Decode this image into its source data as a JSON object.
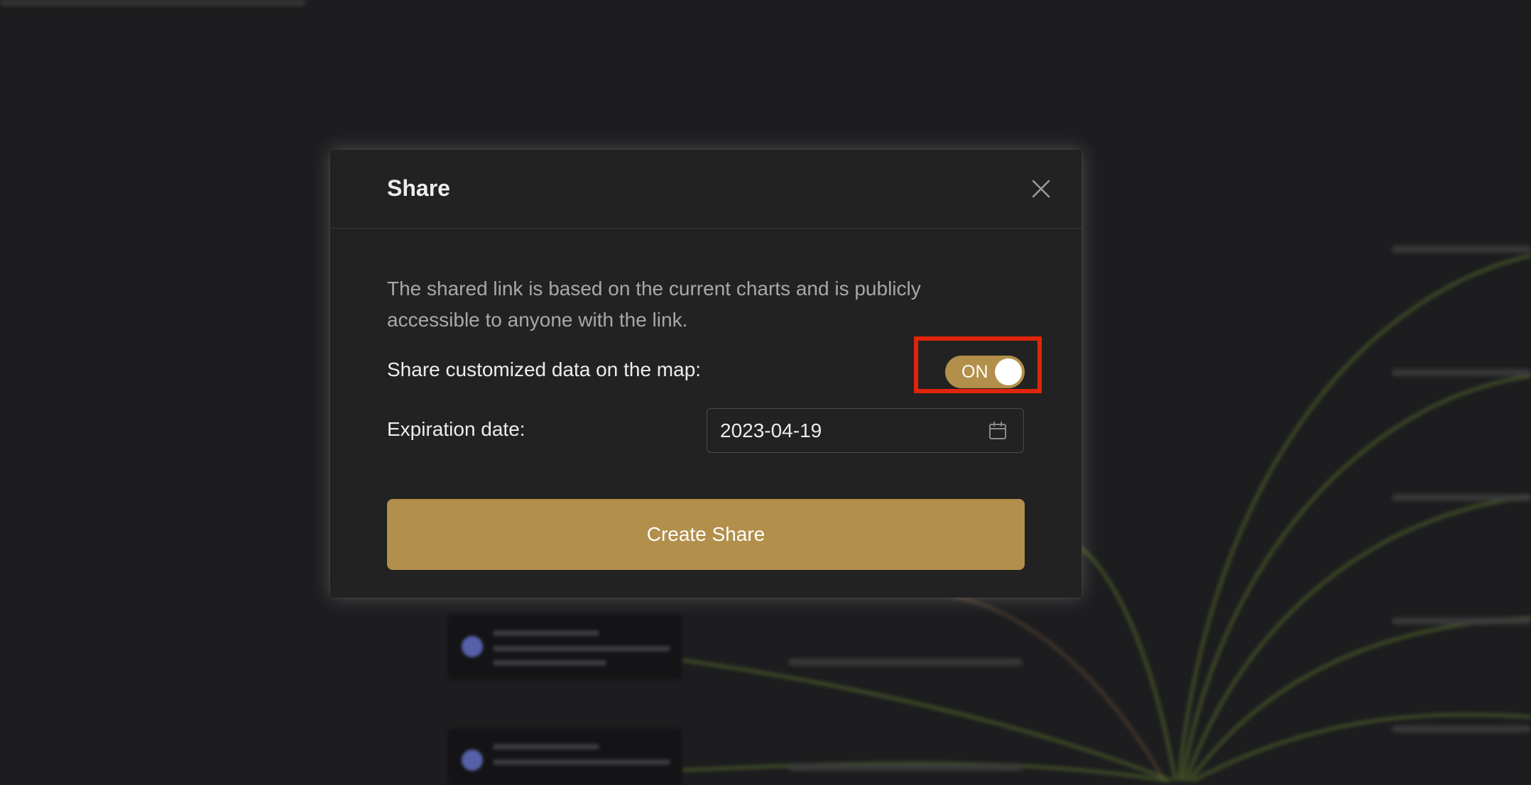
{
  "modal": {
    "title": "Share",
    "description": "The shared link is based on the current charts and is publicly accessible to anyone with the link.",
    "share_custom_label": "Share customized data on the map:",
    "toggle": {
      "state_label": "ON",
      "on": true
    },
    "expiration_label": "Expiration date:",
    "expiration_value": "2023-04-19",
    "create_button_label": "Create Share"
  },
  "colors": {
    "accent": "#b28f4a",
    "highlight": "#e0250c",
    "background": "#1d1d1f",
    "modal_background": "#222222"
  },
  "icons": {
    "close": "close-icon",
    "calendar": "calendar-icon"
  }
}
